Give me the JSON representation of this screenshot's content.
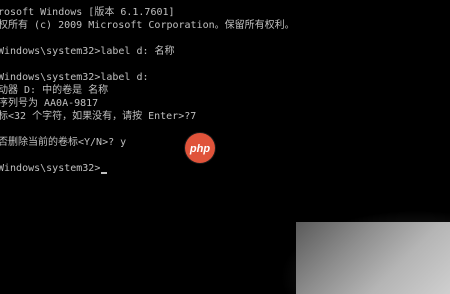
{
  "console": {
    "lines": [
      "rosoft Windows [版本 6.1.7601]",
      "权所有 (c) 2009 Microsoft Corporation。保留所有权利。",
      "",
      "Windows\\system32>label d: 名称",
      "",
      "Windows\\system32>label d:",
      "动器 D: 中的卷是 名称",
      "序列号为 AA0A-9817",
      "标<32 个字符，如果没有，请按 Enter>?7",
      "",
      "否删除当前的卷标<Y/N>? y",
      "",
      "Windows\\system32>"
    ]
  },
  "watermark": {
    "text": "php",
    "color": "#e0533a"
  },
  "colors": {
    "background": "#000000",
    "text": "#c0c0c0"
  }
}
